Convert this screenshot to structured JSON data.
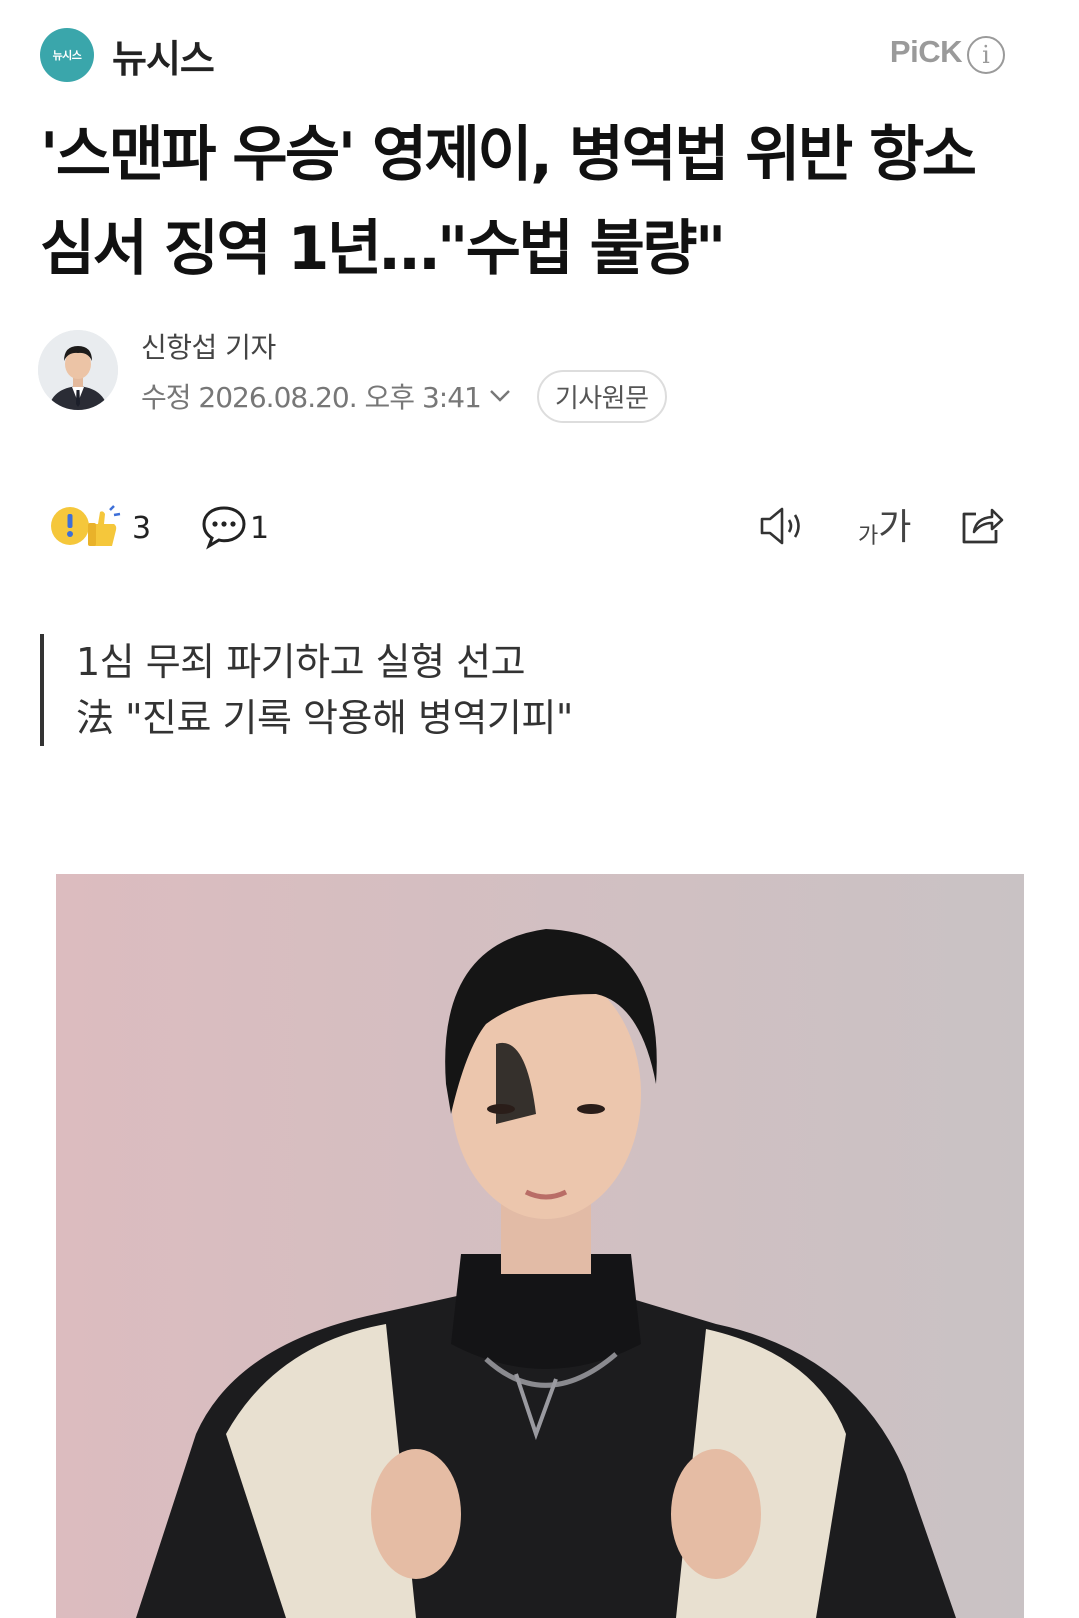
{
  "press": {
    "logo_text": "뉴시스",
    "name": "뉴시스",
    "pick_label": "PiCK",
    "info_symbol": "i"
  },
  "article": {
    "headline_line1": "'스맨파 우승' 영제이, 병역법 위반 항소",
    "headline_line2": "심서 징역 1년…\"수법 불량\"",
    "reporter": "신항섭 기자",
    "timestamp": "수정 2026.08.20. 오후 3:41",
    "original_button": "기사원문",
    "summary": [
      "1심 무죄 파기하고 실형 선고",
      "法 \"진료 기록 악용해 병역기피\""
    ]
  },
  "actions": {
    "reaction_count": "3",
    "comment_count": "1",
    "font_small": "가",
    "font_large": "가"
  },
  "colors": {
    "logo_bg": "#3aa6ab",
    "pick_gray": "#9a9a9a",
    "photo_bg": "#d8b8bc"
  },
  "icons": [
    "press-logo",
    "info-icon",
    "chevron-down-icon",
    "reaction-icon",
    "comment-icon",
    "audio-icon",
    "share-icon"
  ]
}
